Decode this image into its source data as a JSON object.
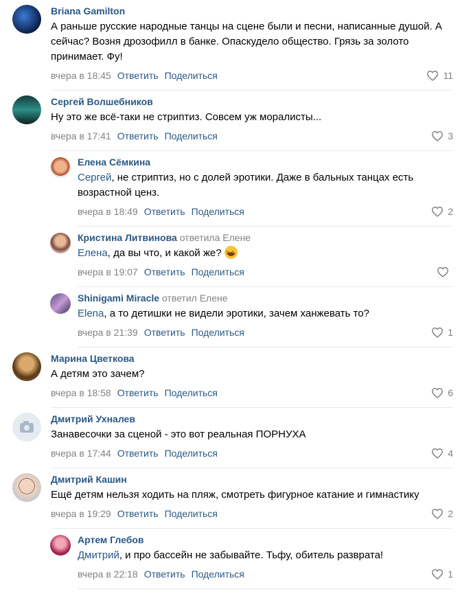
{
  "labels": {
    "reply": "Ответить",
    "share": "Поделиться"
  },
  "comments": [
    {
      "author": "Briana Gamilton",
      "text": "А раньше русские народные танцы на сцене были и песни, написанные душой. А сейчас? Возня дрозофилл в банке. Опаскудело общество. Грязь за золото принимает. Фу!",
      "time": "вчера в 18:45",
      "likes": "11"
    },
    {
      "author": "Сергей Волшебников",
      "text": "Ну это же всё-таки не стриптиз. Совсем уж моралисты...",
      "time": "вчера в 17:41",
      "likes": "3",
      "replies": [
        {
          "author": "Елена Сёмкина",
          "mention": "Сергей",
          "text": ", не стриптиз, но с долей эротики. Даже в бальных танцах есть возрастной ценз.",
          "time": "вчера в 18:49",
          "likes": "2"
        },
        {
          "author": "Кристина Литвинова",
          "replied_to": "ответила Елене",
          "mention": "Елена",
          "text": ", да вы что, и какой же?",
          "emoji": "laughing-face",
          "time": "вчера в 19:07",
          "likes": ""
        },
        {
          "author": "Shinigami Miracle",
          "replied_to": "ответил Елене",
          "mention": "Elena",
          "text": ", а то детишки не видели эротики, зачем ханжевать то?",
          "time": "вчера в 21:39",
          "likes": "1"
        }
      ]
    },
    {
      "author": "Марина Цветкова",
      "text": "А детям это зачем?",
      "time": "вчера в 18:58",
      "likes": "6"
    },
    {
      "author": "Дмитрий Ухналев",
      "text": "Занавесочки за сценой - это вот реальная ПОРНУХА",
      "time": "вчера в 17:44",
      "likes": "4"
    },
    {
      "author": "Дмитрий Кашин",
      "text": "Ещё детям нельзя ходить на пляж, смотреть фигурное катание и гимнастику",
      "time": "вчера в 19:29",
      "likes": "2",
      "replies": [
        {
          "author": "Артем Глебов",
          "mention": "Дмитрий",
          "text": ", и про бассейн не забывайте. Тьфу, обитель разврата!",
          "time": "вчера в 22:18",
          "likes": "1"
        }
      ]
    }
  ],
  "colors": {
    "link": "#2a5885",
    "meta": "#828282",
    "divider": "#e7e8ec"
  }
}
